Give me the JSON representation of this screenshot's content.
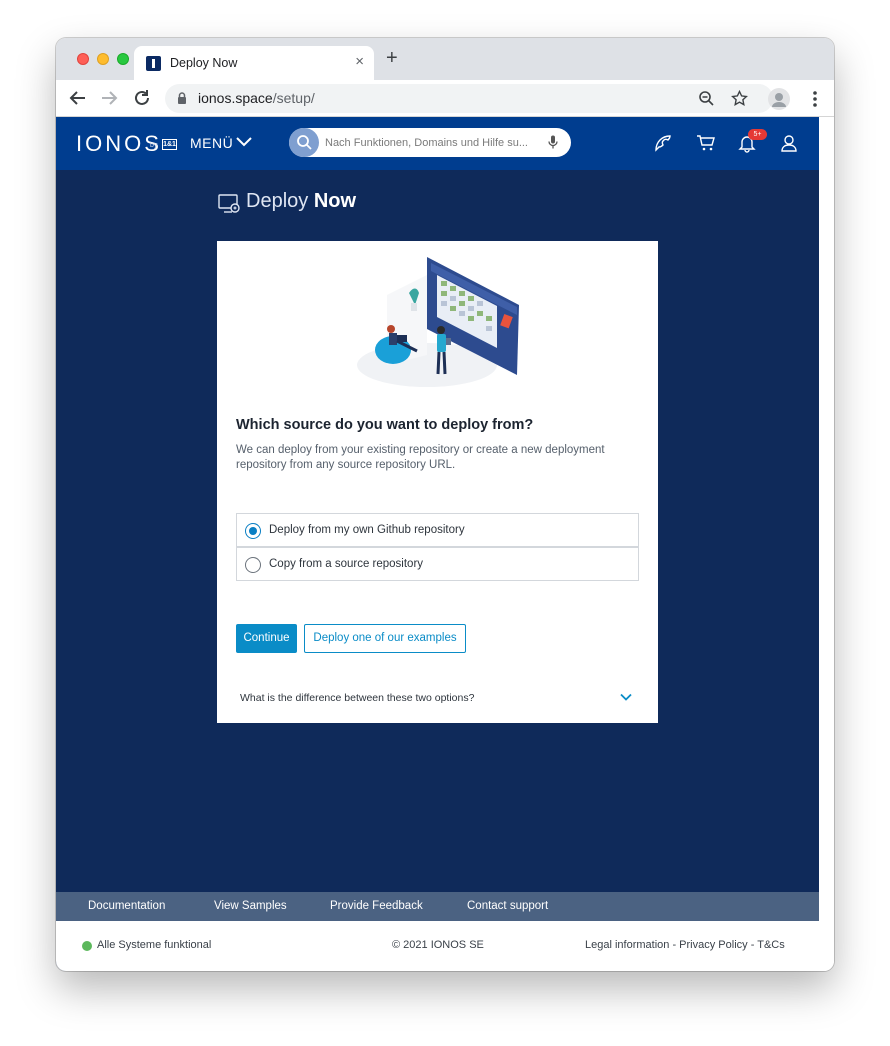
{
  "browser": {
    "tab_title": "Deploy Now",
    "tab_close": "×",
    "new_tab": "+",
    "url_host": "ionos.space",
    "url_path": "/setup/"
  },
  "header": {
    "logo": "IONOS",
    "logo_by": "by",
    "logo_brand": "1&1",
    "menu_label": "MENÜ",
    "search_placeholder": "Nach Funktionen, Domains und Hilfe su...",
    "notification_count": "5+"
  },
  "page": {
    "title_light": "Deploy",
    "title_bold": "Now"
  },
  "card": {
    "question": "Which source do you want to deploy from?",
    "description": "We can deploy from your existing repository or create a new deployment repository from any source repository URL.",
    "options": [
      {
        "label": "Deploy from my own Github repository",
        "selected": true
      },
      {
        "label": "Copy from a source repository",
        "selected": false
      }
    ],
    "continue_label": "Continue",
    "examples_label": "Deploy one of our examples",
    "faq_label": "What is the difference between these two options?"
  },
  "footer": {
    "links": [
      "Documentation",
      "View Samples",
      "Provide Feedback",
      "Contact support"
    ],
    "status": "Alle Systeme funktional",
    "copyright": "© 2021 IONOS SE",
    "legal": "Legal information",
    "privacy": "Privacy Policy",
    "tcs": "T&Cs",
    "separator": " - "
  },
  "colors": {
    "header_bg": "#003d8f",
    "page_bg": "#0f2a5a",
    "primary": "#0a8cc7",
    "status_ok": "#5cb85c",
    "badge": "#e53935"
  }
}
